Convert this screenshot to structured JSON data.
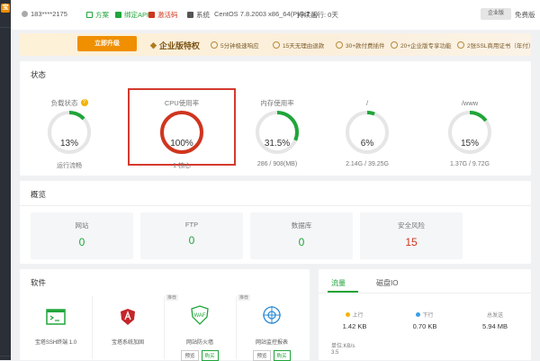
{
  "colors": {
    "green": "#20a53a",
    "red": "#d0351e",
    "orange": "#f08f00",
    "track": "#e6e6e6"
  },
  "sidebar": {
    "logo": "宝"
  },
  "topbar": {
    "user": "183****2175",
    "items": [
      "方案",
      "绑定APP",
      "激活码",
      "系统",
      "CentOS 7.8.2003 x86_64(Py3.7.9)",
      "持续运行: 0天"
    ],
    "enterprise_btn": "企业版",
    "right_text": "免费版"
  },
  "banner": {
    "upgrade_label": "立即升级",
    "title": "企业版特权",
    "features": [
      "5分钟极速响应",
      "15天无理由退款",
      "30+款付费插件",
      "20+企业版专享功能",
      "2张SSL商用证书（年付）"
    ]
  },
  "status": {
    "title": "状态",
    "gauges": [
      {
        "label": "负载状态",
        "value": "13%",
        "sub": "运行流畅",
        "percent": 13,
        "color": "#20a53a",
        "help": "?"
      },
      {
        "label": "CPU使用率",
        "value": "100%",
        "sub": "1 核心",
        "percent": 100,
        "color": "#d0351e"
      },
      {
        "label": "内存使用率",
        "value": "31.5%",
        "sub": "286 / 908(MB)",
        "percent": 31.5,
        "color": "#20a53a"
      },
      {
        "label": "/",
        "value": "6%",
        "sub": "2.14G / 39.25G",
        "percent": 6,
        "color": "#20a53a"
      },
      {
        "label": "/www",
        "value": "15%",
        "sub": "1.37G / 9.72G",
        "percent": 15,
        "color": "#20a53a"
      }
    ]
  },
  "overview": {
    "title": "概览",
    "cards": [
      {
        "label": "网站",
        "value": "0"
      },
      {
        "label": "FTP",
        "value": "0"
      },
      {
        "label": "数据库",
        "value": "0"
      },
      {
        "label": "安全风险",
        "value": "15"
      }
    ]
  },
  "software": {
    "title": "软件",
    "items": [
      {
        "name": "宝塔SSH终端 1.0",
        "icon": "terminal-icon",
        "tag": ""
      },
      {
        "name": "宝塔系统加固",
        "icon": "shield-a-icon",
        "tag": ""
      },
      {
        "name": "网站防火墙",
        "icon": "waf-icon",
        "tag": "推荐",
        "buttons": [
          "预览",
          "购买"
        ]
      },
      {
        "name": "网站监控报表",
        "icon": "monitor-icon",
        "tag": "推荐",
        "buttons": [
          "预览",
          "购买"
        ]
      }
    ]
  },
  "traffic": {
    "tabs": [
      "流量",
      "磁盘IO"
    ],
    "stats": [
      {
        "label": "上行",
        "value": "1.42 KB",
        "dot": "#f3b300"
      },
      {
        "label": "下行",
        "value": "0.70 KB",
        "dot": "#3a9ee8"
      },
      {
        "label": "总发送",
        "value": "5.94 MB",
        "dot": ""
      }
    ],
    "unit": "单位:KB/s",
    "ytick": "3.5"
  }
}
